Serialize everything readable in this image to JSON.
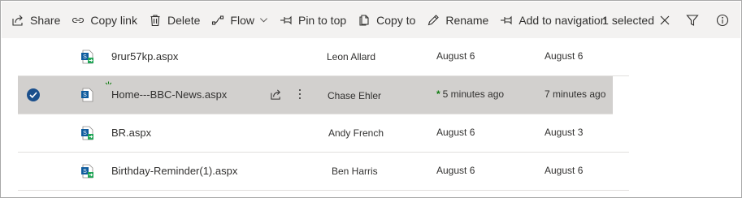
{
  "command_bar": {
    "share": "Share",
    "copy_link": "Copy link",
    "delete": "Delete",
    "flow": "Flow",
    "pin_to_top": "Pin to top",
    "copy_to": "Copy to",
    "rename": "Rename",
    "add_to_navigation": "Add to navigation",
    "more": "···",
    "selected_count": "1 selected"
  },
  "files": [
    {
      "name": "9rur57kp.aspx",
      "modified_by": "Leon Allard",
      "modified": "August 6",
      "created": "August 6",
      "selected": false,
      "new": false
    },
    {
      "name": "Home---BBC-News.aspx",
      "modified_by": "Chase Ehler",
      "modified": "5 minutes ago",
      "created": "7 minutes ago",
      "selected": true,
      "new": true
    },
    {
      "name": "BR.aspx",
      "modified_by": "Andy French",
      "modified": "August 6",
      "created": "August 3",
      "selected": false,
      "new": false
    },
    {
      "name": "Birthday-Reminder(1).aspx",
      "modified_by": "Ben Harris",
      "modified": "August 6",
      "created": "August 6",
      "selected": false,
      "new": false
    }
  ],
  "icons": {
    "file_icon": "sharepoint-page-icon",
    "selected_check": "check-circle-icon",
    "new_item": "new-item-sparkle-icon",
    "modified_star": "*"
  },
  "colors": {
    "command_bar_bg": "#f3f2f1",
    "selected_row_bg": "#d2d0ce",
    "check_blue": "#1b4f8c",
    "new_green": "#107c10",
    "file_icon_green": "#22a557",
    "file_icon_blue": "#0f5c9e"
  }
}
